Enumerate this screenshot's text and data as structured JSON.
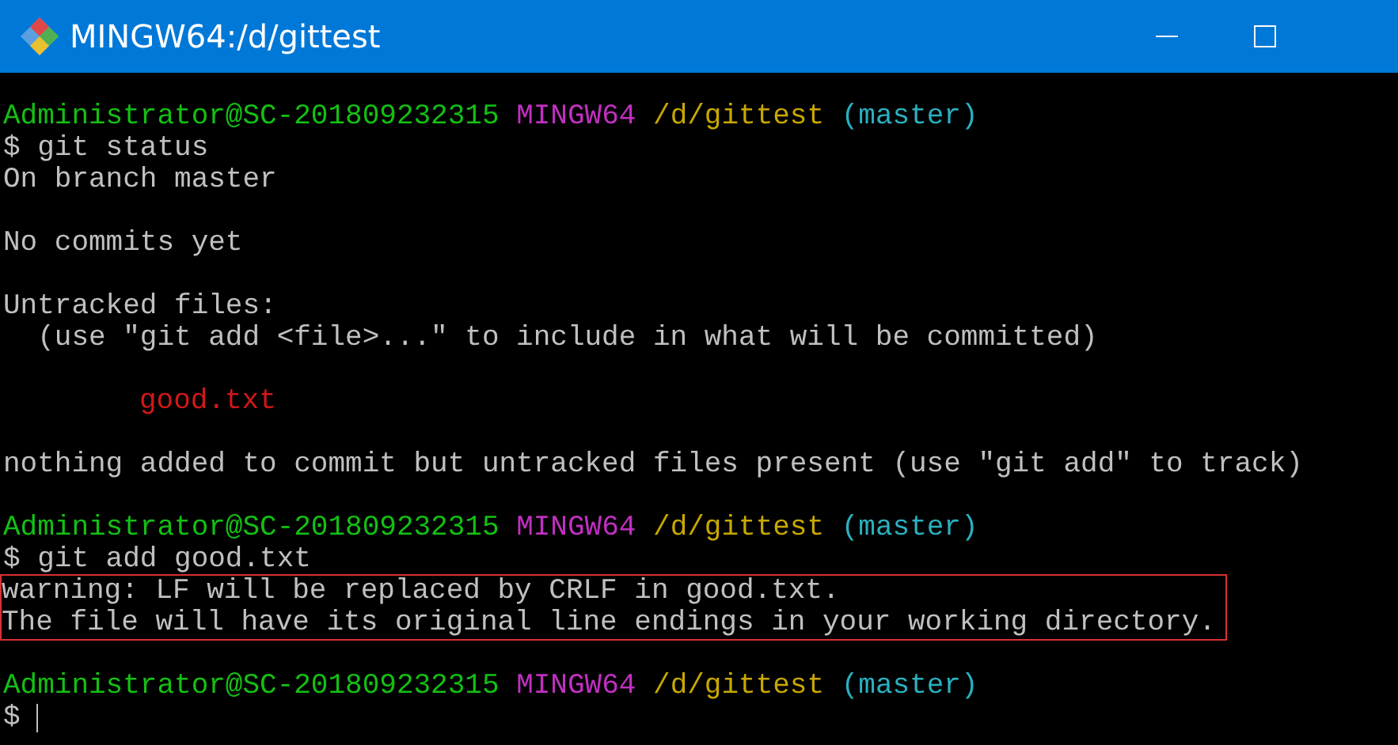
{
  "window": {
    "title": "MINGW64:/d/gittest"
  },
  "lines": [
    {
      "kind": "prompt",
      "user": "Administrator@SC-201809232315",
      "system": "MINGW64",
      "path": "/d/gittest",
      "branch": "(master)"
    },
    {
      "kind": "text",
      "text": "$ git status"
    },
    {
      "kind": "text",
      "text": "On branch master"
    },
    {
      "kind": "blank"
    },
    {
      "kind": "text",
      "text": "No commits yet"
    },
    {
      "kind": "blank"
    },
    {
      "kind": "text",
      "text": "Untracked files:"
    },
    {
      "kind": "text",
      "text": "  (use \"git add <file>...\" to include in what will be committed)"
    },
    {
      "kind": "blank"
    },
    {
      "kind": "untracked",
      "text": "good.txt"
    },
    {
      "kind": "blank"
    },
    {
      "kind": "text",
      "text": "nothing added to commit but untracked files present (use \"git add\" to track)"
    },
    {
      "kind": "blank"
    },
    {
      "kind": "prompt",
      "user": "Administrator@SC-201809232315",
      "system": "MINGW64",
      "path": "/d/gittest",
      "branch": "(master)"
    },
    {
      "kind": "text",
      "text": "$ git add good.txt"
    },
    {
      "kind": "highlight",
      "lines": [
        "warning: LF will be replaced by CRLF in good.txt.",
        "The file will have its original line endings in your working directory."
      ]
    },
    {
      "kind": "blank"
    },
    {
      "kind": "prompt",
      "user": "Administrator@SC-201809232315",
      "system": "MINGW64",
      "path": "/d/gittest",
      "branch": "(master)"
    },
    {
      "kind": "input",
      "text": "$"
    }
  ]
}
